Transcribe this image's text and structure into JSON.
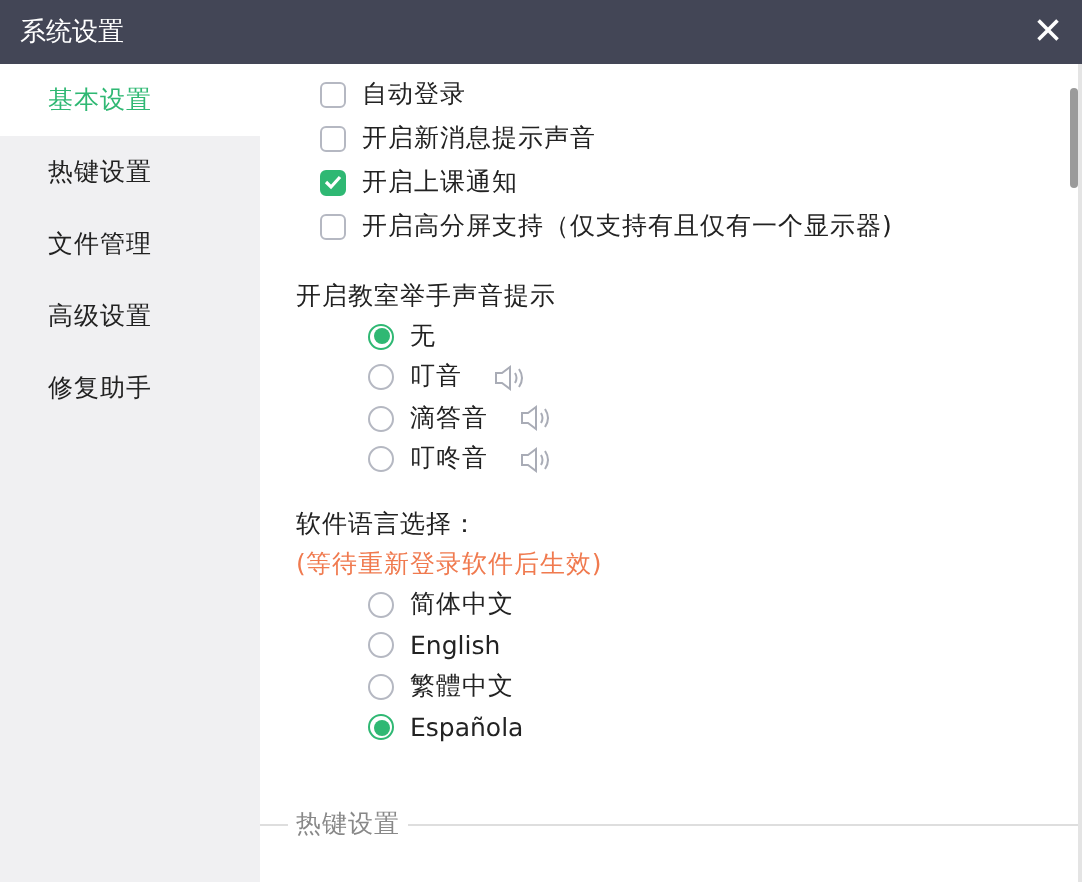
{
  "window": {
    "title": "系统设置",
    "close": "×"
  },
  "sidebar": {
    "items": [
      {
        "label": "基本设置",
        "selected": true
      },
      {
        "label": "热键设置",
        "selected": false
      },
      {
        "label": "文件管理",
        "selected": false
      },
      {
        "label": "高级设置",
        "selected": false
      },
      {
        "label": "修复助手",
        "selected": false
      }
    ]
  },
  "options": [
    {
      "label": "自动登录",
      "checked": false
    },
    {
      "label": "开启新消息提示声音",
      "checked": false
    },
    {
      "label": "开启上课通知",
      "checked": true
    },
    {
      "label": "开启高分屏支持（仅支持有且仅有一个显示器)",
      "checked": false
    }
  ],
  "hand_raise": {
    "title": "开启教室举手声音提示",
    "choices": [
      {
        "label": "无",
        "selected": true,
        "kind": "plain"
      },
      {
        "label": "叮音",
        "selected": false,
        "kind": "sound"
      },
      {
        "label": "滴答音",
        "selected": false,
        "kind": "sound"
      },
      {
        "label": "叮咚音",
        "selected": false,
        "kind": "sound"
      }
    ]
  },
  "language": {
    "title": "软件语言选择：",
    "note": "(等待重新登录软件后生效)",
    "choices": [
      {
        "label": "简体中文",
        "selected": false
      },
      {
        "label": "English",
        "selected": false
      },
      {
        "label": "繁體中文",
        "selected": false
      },
      {
        "label": "Española",
        "selected": true
      }
    ]
  },
  "next_section": {
    "title": "热键设置"
  }
}
